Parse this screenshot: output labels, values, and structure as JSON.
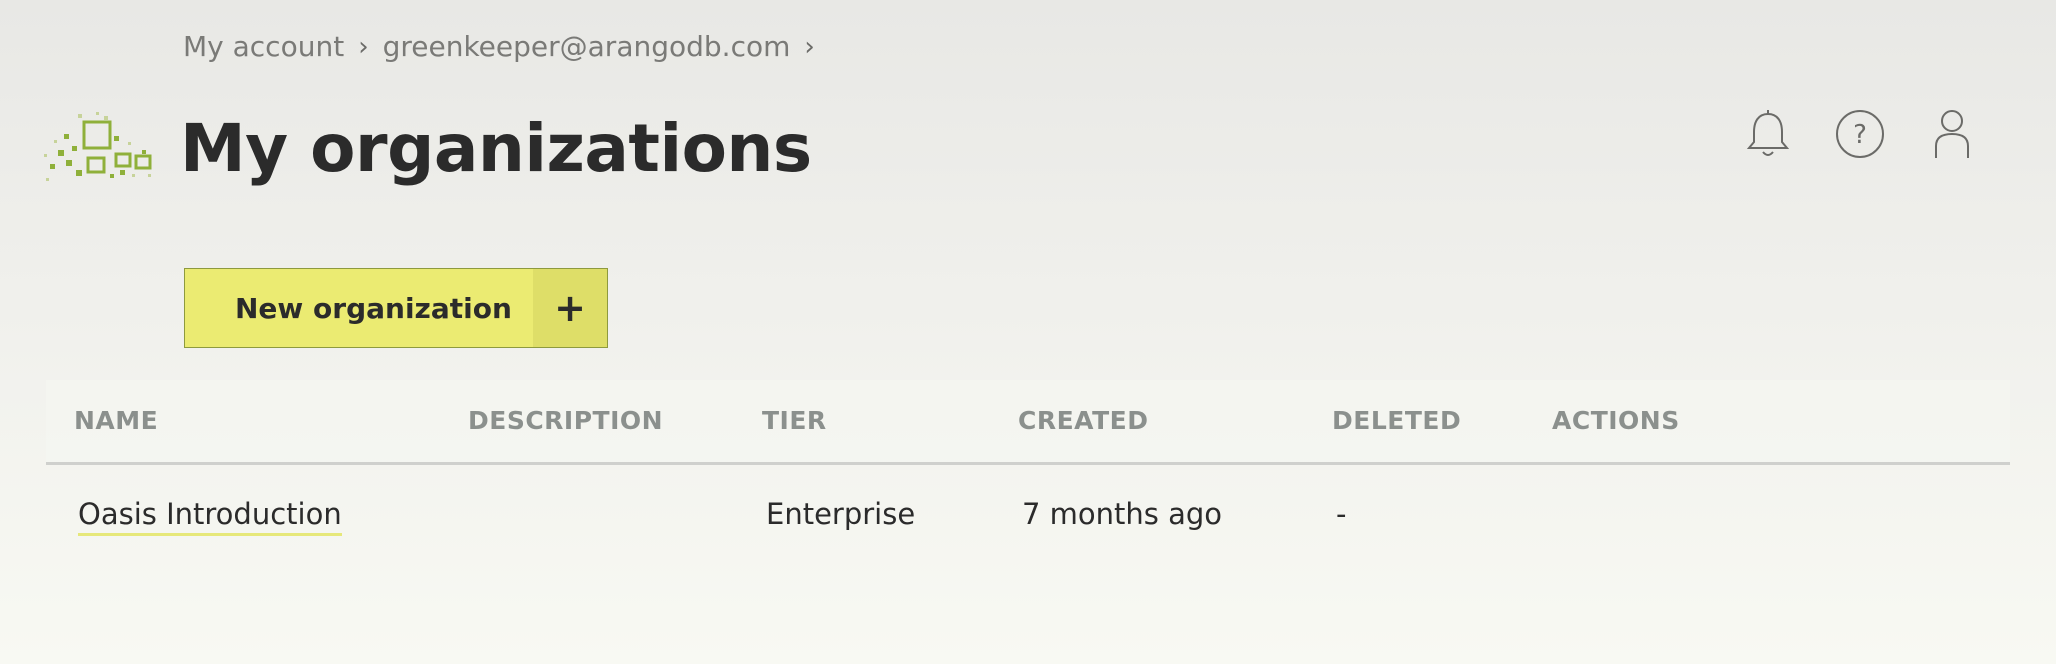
{
  "breadcrumb": {
    "items": [
      "My account",
      "greenkeeper@arangodb.com"
    ],
    "separator": "›"
  },
  "page": {
    "title": "My organizations"
  },
  "header_icons": [
    "bell-icon",
    "help-icon",
    "user-icon"
  ],
  "actions": {
    "new_org_label": "New organization",
    "new_org_plus": "+"
  },
  "table": {
    "columns": [
      "NAME",
      "DESCRIPTION",
      "TIER",
      "CREATED",
      "DELETED",
      "ACTIONS"
    ],
    "rows": [
      {
        "name": "Oasis Introduction",
        "description": "",
        "tier": "Enterprise",
        "created": "7 months ago",
        "deleted": "-",
        "actions": ""
      }
    ]
  },
  "colors": {
    "accent": "#ebeb72",
    "accent_dark": "#dede68",
    "logo_green": "#8fb03a",
    "text": "#2b2b2b",
    "header_text": "#8b908d"
  }
}
